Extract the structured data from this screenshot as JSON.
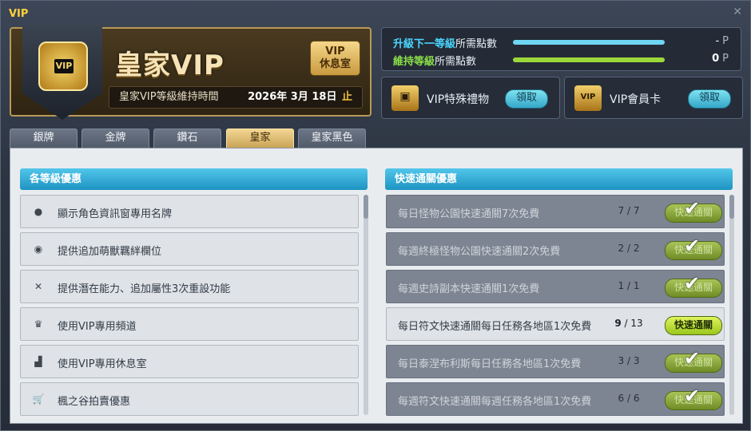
{
  "window": {
    "title": "VIP",
    "close_icon": "close-icon"
  },
  "header": {
    "royal_title": "皇家VIP",
    "badge_text": "VIP",
    "lounge_button": {
      "line1": "VIP",
      "line2": "休息室"
    },
    "keep_time_label": "皇家VIP等級維持時間",
    "keep_date": "2026年 3月 18日",
    "keep_date_suffix": "止"
  },
  "points": {
    "next_level": {
      "highlight": "升級下一等級",
      "rest": "所需點數",
      "value": "-",
      "unit": "P",
      "bar_color": "#6fd6f4",
      "fill_fraction": 1.0
    },
    "maintain_level": {
      "highlight": "維持等級",
      "rest": "所需點數",
      "value": "0",
      "unit": "P",
      "bar_color": "#9cd83a",
      "fill_fraction": 1.0
    }
  },
  "gifts": [
    {
      "label": "VIP特殊禮物",
      "button": "領取",
      "icon": "treasure-chest-icon",
      "glyph": "▣"
    },
    {
      "label": "VIP會員卡",
      "button": "領取",
      "icon": "vip-card-icon",
      "glyph": "VIP"
    }
  ],
  "tabs": [
    {
      "label": "銀牌",
      "active": false
    },
    {
      "label": "金牌",
      "active": false
    },
    {
      "label": "鑽石",
      "active": false
    },
    {
      "label": "皇家",
      "active": true
    },
    {
      "label": "皇家黑色",
      "active": false
    }
  ],
  "left_panel": {
    "title": "各等級優惠",
    "items": [
      {
        "icon": "person-icon",
        "glyph": "●",
        "text": "顯示角色資訊窗專用名牌"
      },
      {
        "icon": "pet-slot-icon",
        "glyph": "◉",
        "text": "提供追加萌獸羈絆欄位"
      },
      {
        "icon": "potential-reset-icon",
        "glyph": "✕",
        "text": "提供潛在能力、追加屬性3次重設功能"
      },
      {
        "icon": "crown-icon",
        "glyph": "♛",
        "text": "使用VIP專用頻道"
      },
      {
        "icon": "chair-icon",
        "glyph": "▟",
        "text": "使用VIP專用休息室"
      },
      {
        "icon": "cart-icon",
        "glyph": "🛒",
        "text": "楓之谷拍賣優惠"
      }
    ]
  },
  "right_panel": {
    "title": "快速通關優惠",
    "items": [
      {
        "text": "每日怪物公園快速通關7次免費",
        "used": "7",
        "total": "7",
        "button": "快速通關",
        "completed": true
      },
      {
        "text": "每週終極怪物公園快速通關2次免費",
        "used": "2",
        "total": "2",
        "button": "快速通關",
        "completed": true
      },
      {
        "text": "每週史詩副本快速通關1次免費",
        "used": "1",
        "total": "1",
        "button": "快速通關",
        "completed": true
      },
      {
        "text": "每日符文快速通關每日任務各地區1次免費",
        "used": "9",
        "total": "13",
        "button": "快速通關",
        "completed": false
      },
      {
        "text": "每日泰涅布利斯每日任務各地區1次免費",
        "used": "3",
        "total": "3",
        "button": "快速通關",
        "completed": true
      },
      {
        "text": "每週符文快速通關每週任務各地區1次免費",
        "used": "6",
        "total": "6",
        "button": "快速通關",
        "completed": true
      }
    ]
  }
}
